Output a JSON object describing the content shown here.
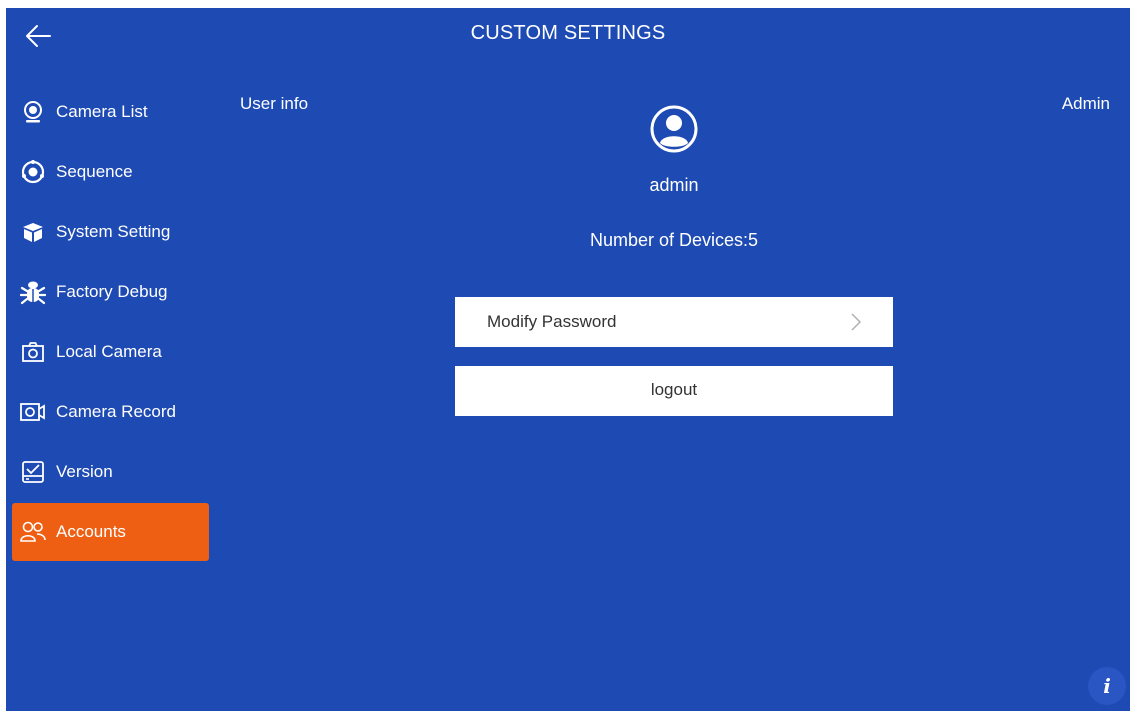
{
  "header": {
    "title": "CUSTOM SETTINGS",
    "back_icon": "arrow-left-icon"
  },
  "sidebar": {
    "items": [
      {
        "label": "Camera List",
        "icon": "webcam-icon",
        "active": false
      },
      {
        "label": "Sequence",
        "icon": "sequence-icon",
        "active": false
      },
      {
        "label": "System Setting",
        "icon": "box-icon",
        "active": false
      },
      {
        "label": "Factory Debug",
        "icon": "bug-icon",
        "active": false
      },
      {
        "label": "Local Camera",
        "icon": "camera-icon",
        "active": false
      },
      {
        "label": "Camera Record",
        "icon": "video-camera-icon",
        "active": false
      },
      {
        "label": "Version",
        "icon": "version-check-icon",
        "active": false
      },
      {
        "label": "Accounts",
        "icon": "users-icon",
        "active": true
      }
    ]
  },
  "main": {
    "section_label": "User info",
    "role": "Admin",
    "avatar_icon": "user-avatar-icon",
    "username": "admin",
    "devices": "Number of Devices:5",
    "modify_password": "Modify Password",
    "logout": "logout",
    "info": "i"
  },
  "colors": {
    "background": "#1e4ab3",
    "active": "#ee5f14",
    "button": "#ffffff",
    "button_text": "#333333"
  }
}
